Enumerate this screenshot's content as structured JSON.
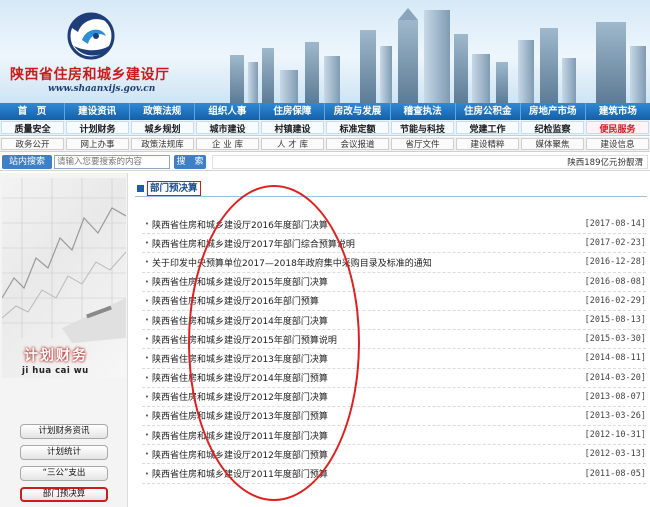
{
  "header": {
    "site_name": "陕西省住房和城乡建设厅",
    "site_url": "www.shaanxijs.gov.cn"
  },
  "nav_main": [
    "首　页",
    "建设资讯",
    "政策法规",
    "组织人事",
    "住房保障",
    "房改与发展",
    "稽查执法",
    "住房公积金",
    "房地产市场",
    "建筑市场"
  ],
  "nav_sub": [
    {
      "label": "质量安全",
      "hot": false
    },
    {
      "label": "计划财务",
      "hot": false
    },
    {
      "label": "城乡规划",
      "hot": false
    },
    {
      "label": "城市建设",
      "hot": false
    },
    {
      "label": "村镇建设",
      "hot": false
    },
    {
      "label": "标准定额",
      "hot": false
    },
    {
      "label": "节能与科技",
      "hot": false
    },
    {
      "label": "党建工作",
      "hot": false
    },
    {
      "label": "纪检监察",
      "hot": false
    },
    {
      "label": "便民服务",
      "hot": true
    }
  ],
  "nav_third": [
    "政务公开",
    "网上办事",
    "政策法规库",
    "企 业 库",
    "人 才 库",
    "会议报道",
    "省厅文件",
    "建设精粹",
    "媒体聚焦",
    "建设信息"
  ],
  "search": {
    "label": "站内搜索",
    "placeholder": "请输入您要搜索的内容",
    "button": "搜　索",
    "ticker": "陕西189亿元扮靓渭"
  },
  "sidebar": {
    "title": "计划财务",
    "pinyin": "ji hua cai wu",
    "buttons": [
      {
        "label": "计划财务资讯",
        "active": false
      },
      {
        "label": "计划统计",
        "active": false
      },
      {
        "label": "“三公”支出",
        "active": false
      },
      {
        "label": "部门预决算",
        "active": true
      }
    ]
  },
  "section": {
    "title": "部门预决算"
  },
  "news": [
    {
      "title": "陕西省住房和城乡建设厅2016年度部门决算",
      "date": "[2017-08-14]"
    },
    {
      "title": "陕西省住房和城乡建设厅2017年部门综合预算说明",
      "date": "[2017-02-23]"
    },
    {
      "title": "关于印发中央预算单位2017—2018年政府集中采购目录及标准的通知",
      "date": "[2016-12-28]"
    },
    {
      "title": "陕西省住房和城乡建设厅2015年度部门决算",
      "date": "[2016-08-08]"
    },
    {
      "title": "陕西省住房和城乡建设厅2016年部门预算",
      "date": "[2016-02-29]"
    },
    {
      "title": "陕西省住房和城乡建设厅2014年度部门决算",
      "date": "[2015-08-13]"
    },
    {
      "title": "陕西省住房和城乡建设厅2015年部门预算说明",
      "date": "[2015-03-30]"
    },
    {
      "title": "陕西省住房和城乡建设厅2013年度部门决算",
      "date": "[2014-08-11]"
    },
    {
      "title": "陕西省住房和城乡建设厅2014年度部门预算",
      "date": "[2014-03-20]"
    },
    {
      "title": "陕西省住房和城乡建设厅2012年度部门决算",
      "date": "[2013-08-07]"
    },
    {
      "title": "陕西省住房和城乡建设厅2013年度部门预算",
      "date": "[2013-03-26]"
    },
    {
      "title": "陕西省住房和城乡建设厅2011年度部门决算",
      "date": "[2012-10-31]"
    },
    {
      "title": "陕西省住房和城乡建设厅2012年度部门预算",
      "date": "[2012-03-13]"
    },
    {
      "title": "陕西省住房和城乡建设厅2011年度部门预算",
      "date": "[2011-08-05]"
    }
  ]
}
